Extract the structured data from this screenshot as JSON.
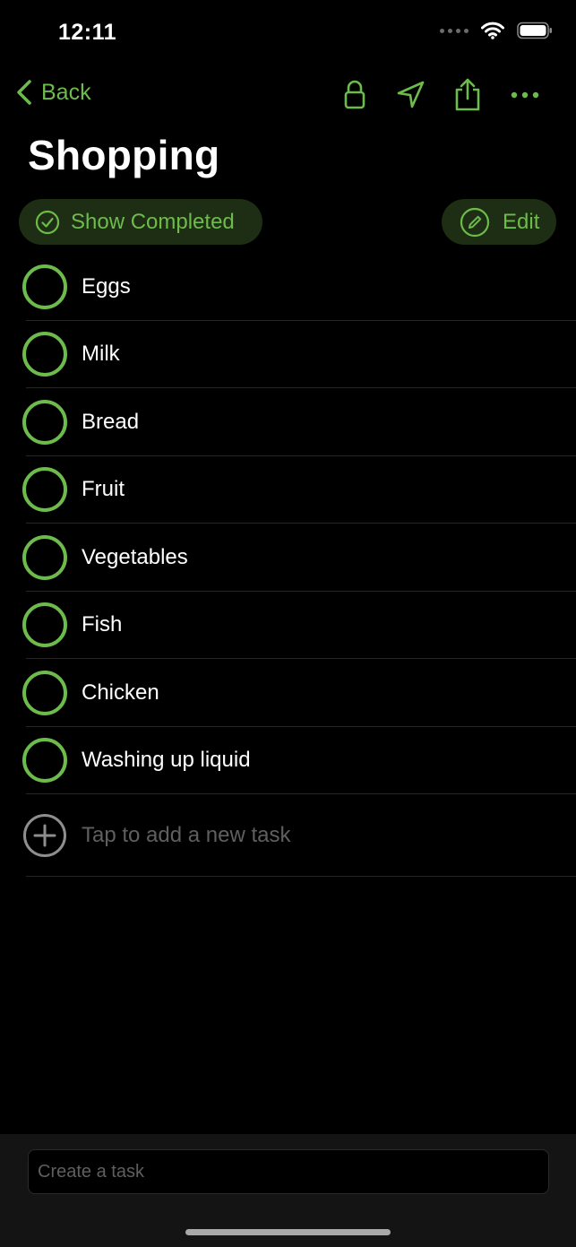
{
  "status_bar": {
    "time": "12:11"
  },
  "nav": {
    "back_label": "Back"
  },
  "page": {
    "title": "Shopping"
  },
  "actions": {
    "show_completed": "Show Completed",
    "edit": "Edit"
  },
  "tasks": [
    {
      "label": "Eggs"
    },
    {
      "label": "Milk"
    },
    {
      "label": "Bread"
    },
    {
      "label": "Fruit"
    },
    {
      "label": "Vegetables"
    },
    {
      "label": "Fish"
    },
    {
      "label": "Chicken"
    },
    {
      "label": "Washing up liquid"
    }
  ],
  "add_task": {
    "label": "Tap to add a new task"
  },
  "create_task": {
    "placeholder": "Create a task"
  },
  "colors": {
    "accent": "#6dbb4b",
    "pill_bg": "#1d2e14",
    "background": "#000000"
  }
}
